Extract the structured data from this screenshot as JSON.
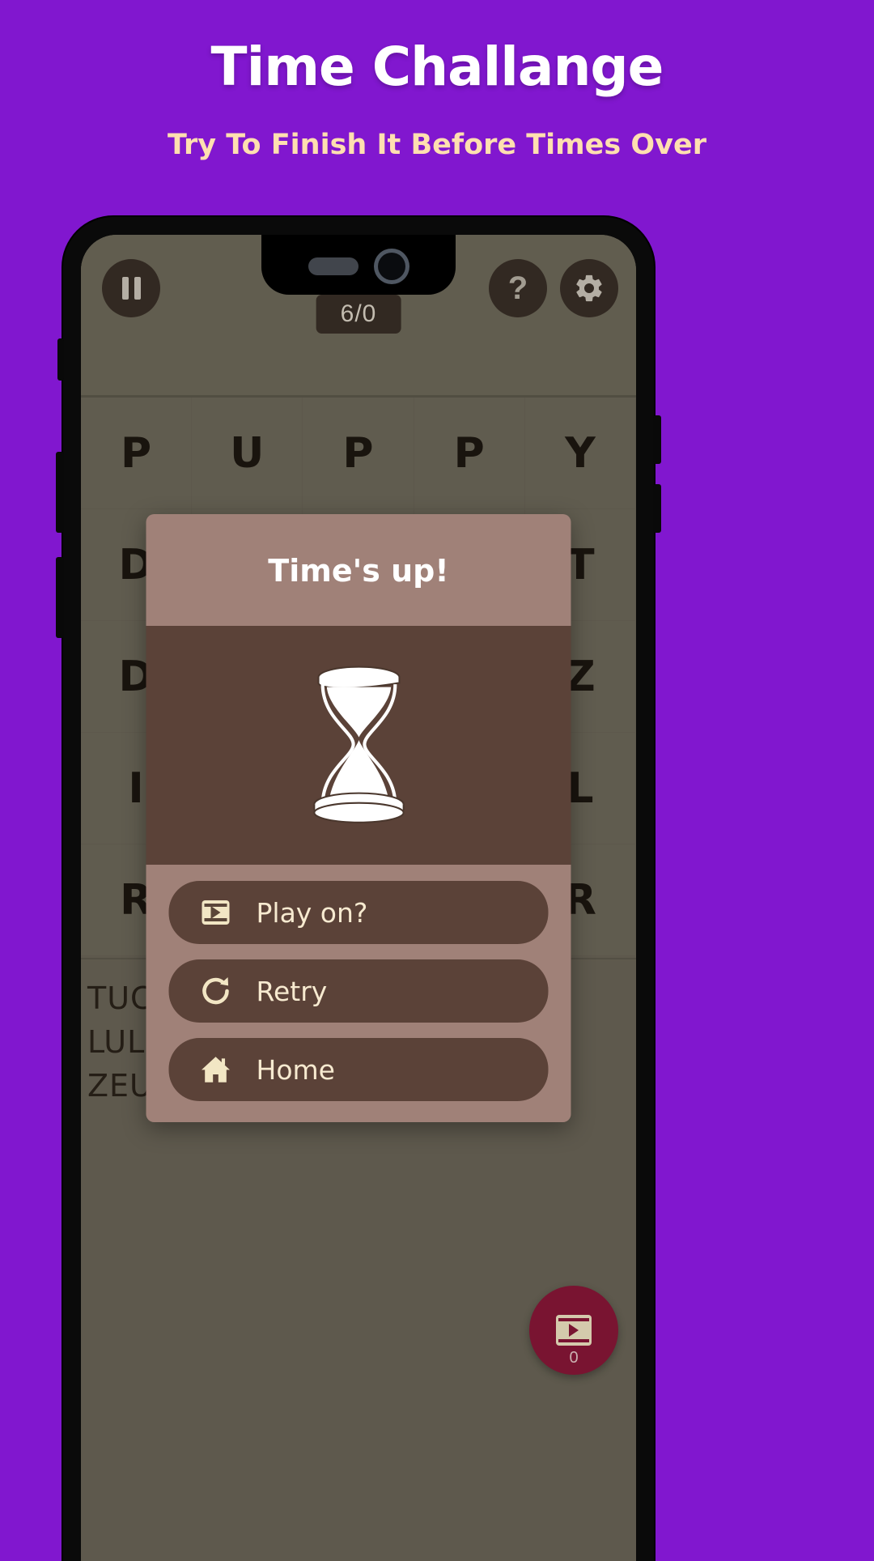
{
  "promo": {
    "title": "Time Challange",
    "subtitle": "Try To Finish It Before Times Over",
    "bg_color": "#8117cf",
    "title_color": "#ffffff",
    "subtitle_color": "#ffdfb0"
  },
  "game": {
    "score_pill": "6/0",
    "pause_icon": "pause-icon",
    "help_icon": "question-mark-icon",
    "help_label": "?",
    "settings_icon": "gear-icon",
    "grid": {
      "rows": [
        [
          "P",
          "U",
          "P",
          "P",
          "Y"
        ],
        [
          "D",
          "",
          "",
          "",
          "T"
        ],
        [
          "D",
          "",
          "",
          "",
          "Z"
        ],
        [
          "I",
          "",
          "",
          "",
          "L"
        ],
        [
          "R",
          "",
          "",
          "",
          "R"
        ]
      ]
    },
    "found_words": [
      "TUCK",
      "LULL",
      "ZEUS"
    ],
    "ad_fab": {
      "icon": "video-ad-icon",
      "count": "0",
      "color": "#8a1738"
    }
  },
  "modal": {
    "title": "Time's up!",
    "illustration": "hourglass-icon",
    "header_color": "#a08178",
    "body_color": "#5b4238",
    "text_color": "#f7ead0",
    "buttons": [
      {
        "label": "Play on?",
        "icon": "video-ad-icon"
      },
      {
        "label": "Retry",
        "icon": "refresh-icon"
      },
      {
        "label": "Home",
        "icon": "home-icon"
      }
    ]
  }
}
